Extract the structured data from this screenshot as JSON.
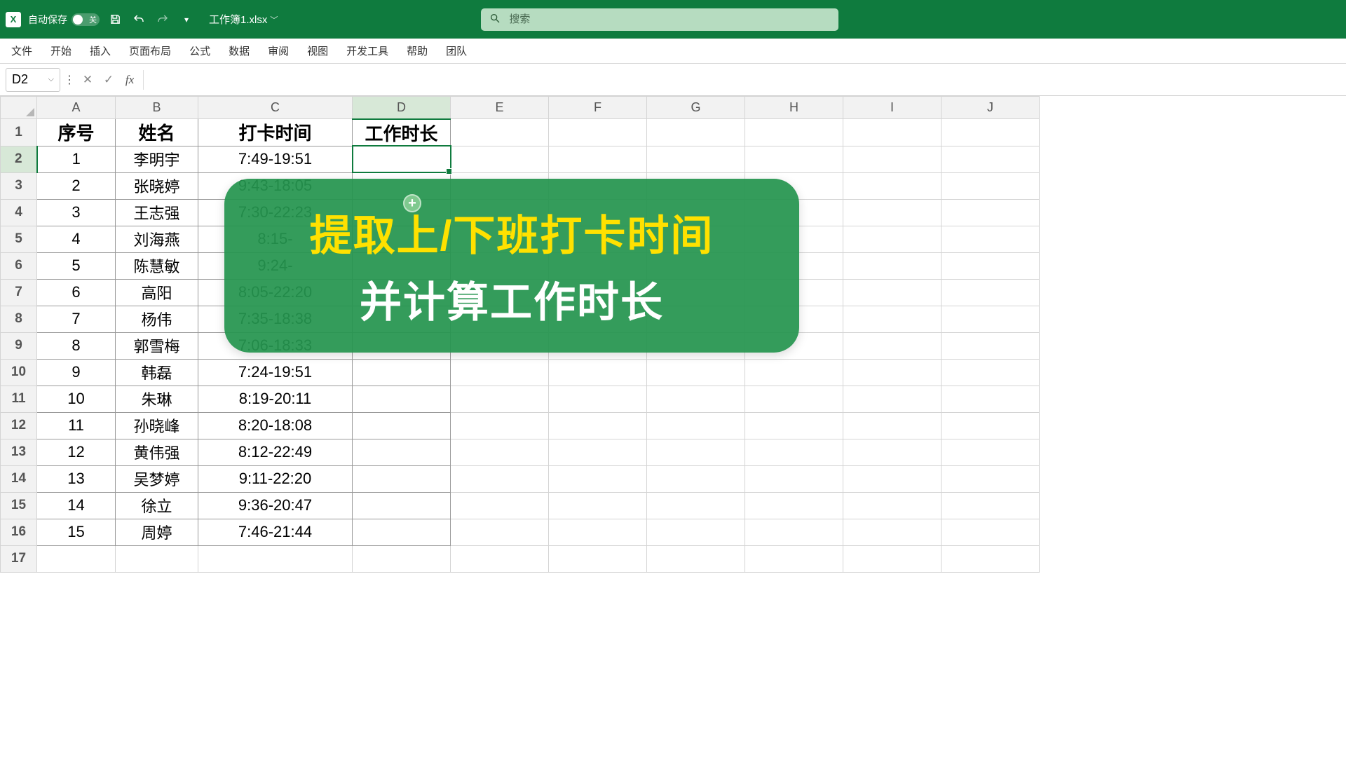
{
  "titlebar": {
    "autosave_label": "自动保存",
    "autosave_state": "关",
    "filename": "工作簿1.xlsx",
    "search_placeholder": "搜索"
  },
  "ribbon": {
    "tabs": [
      "文件",
      "开始",
      "插入",
      "页面布局",
      "公式",
      "数据",
      "审阅",
      "视图",
      "开发工具",
      "帮助",
      "团队"
    ]
  },
  "formulabar": {
    "namebox": "D2",
    "formula": ""
  },
  "grid": {
    "columns": [
      "A",
      "B",
      "C",
      "D",
      "E",
      "F",
      "G",
      "H",
      "I",
      "J"
    ],
    "selected_col": "D",
    "selected_row": 2,
    "row_count": 17,
    "headers": [
      "序号",
      "姓名",
      "打卡时间",
      "工作时长"
    ],
    "rows": [
      {
        "no": "1",
        "name": "李明宇",
        "time": "7:49-19:51",
        "dur": ""
      },
      {
        "no": "2",
        "name": "张晓婷",
        "time": "9:43-18:05",
        "dur": ""
      },
      {
        "no": "3",
        "name": "王志强",
        "time": "7:30-22:23",
        "dur": ""
      },
      {
        "no": "4",
        "name": "刘海燕",
        "time": "8:15-",
        "dur": ""
      },
      {
        "no": "5",
        "name": "陈慧敏",
        "time": "9:24-",
        "dur": ""
      },
      {
        "no": "6",
        "name": "高阳",
        "time": "8:05-22:20",
        "dur": ""
      },
      {
        "no": "7",
        "name": "杨伟",
        "time": "7:35-18:38",
        "dur": ""
      },
      {
        "no": "8",
        "name": "郭雪梅",
        "time": "7:06-18:33",
        "dur": ""
      },
      {
        "no": "9",
        "name": "韩磊",
        "time": "7:24-19:51",
        "dur": ""
      },
      {
        "no": "10",
        "name": "朱琳",
        "time": "8:19-20:11",
        "dur": ""
      },
      {
        "no": "11",
        "name": "孙晓峰",
        "time": "8:20-18:08",
        "dur": ""
      },
      {
        "no": "12",
        "name": "黄伟强",
        "time": "8:12-22:49",
        "dur": ""
      },
      {
        "no": "13",
        "name": "吴梦婷",
        "time": "9:11-22:20",
        "dur": ""
      },
      {
        "no": "14",
        "name": "徐立",
        "time": "9:36-20:47",
        "dur": ""
      },
      {
        "no": "15",
        "name": "周婷",
        "time": "7:46-21:44",
        "dur": ""
      }
    ]
  },
  "overlay": {
    "line1": "提取上/下班打卡时间",
    "line2": "并计算工作时长"
  }
}
